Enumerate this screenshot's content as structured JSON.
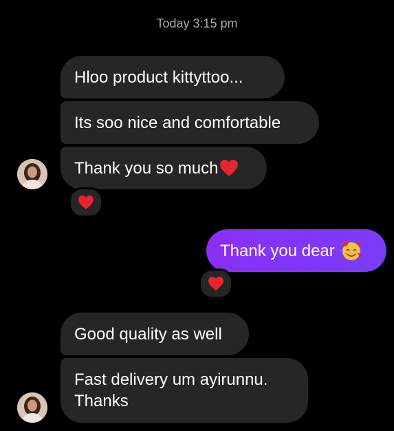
{
  "conversation": {
    "timestamp": "Today 3:15 pm",
    "messages": [
      {
        "text": "Hloo product kittyttoo..."
      },
      {
        "text": "Its soo nice and comfortable"
      },
      {
        "text": "Thank you so much",
        "emoji": "red-heart"
      },
      {
        "text": "Thank you dear",
        "emoji": "smiling-face-with-hearts"
      },
      {
        "text": "Good quality as well"
      },
      {
        "line1": "Fast delivery um ayirunnu.",
        "line2": "Thanks"
      }
    ],
    "reactions": [
      "red-heart",
      "red-heart"
    ]
  },
  "colors": {
    "background": "#000000",
    "incoming_bubble": "#262626",
    "outgoing_bubble": "#7b2ff7",
    "timestamp": "#a8a8a8",
    "heart": "#e8242f"
  }
}
